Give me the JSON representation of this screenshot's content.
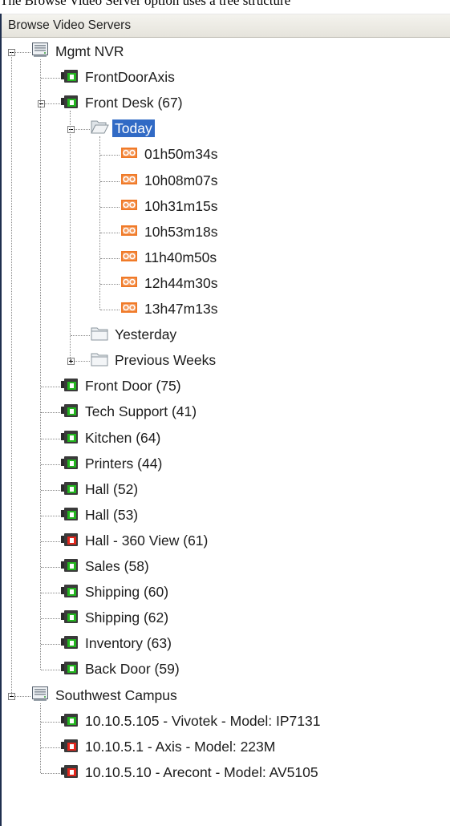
{
  "caption": "The Browse Video Server option uses a tree structure",
  "panel": {
    "title": "Browse Video Servers"
  },
  "tree": [
    {
      "label": "Mgmt NVR",
      "icon": "server",
      "expand": "minus",
      "children": [
        {
          "label": "FrontDoorAxis",
          "icon": "camera-green"
        },
        {
          "label": "Front Desk (67)",
          "icon": "camera-green",
          "expand": "minus",
          "children": [
            {
              "label": "Today",
              "icon": "folder-open",
              "expand": "minus",
              "selected": true,
              "children": [
                {
                  "label": "01h50m34s",
                  "icon": "clip"
                },
                {
                  "label": "10h08m07s",
                  "icon": "clip"
                },
                {
                  "label": "10h31m15s",
                  "icon": "clip"
                },
                {
                  "label": "10h53m18s",
                  "icon": "clip"
                },
                {
                  "label": "11h40m50s",
                  "icon": "clip"
                },
                {
                  "label": "12h44m30s",
                  "icon": "clip"
                },
                {
                  "label": "13h47m13s",
                  "icon": "clip"
                }
              ]
            },
            {
              "label": "Yesterday",
              "icon": "folder"
            },
            {
              "label": "Previous Weeks",
              "icon": "folder",
              "expand": "plus"
            }
          ]
        },
        {
          "label": "Front Door (75)",
          "icon": "camera-green"
        },
        {
          "label": "Tech Support (41)",
          "icon": "camera-green"
        },
        {
          "label": "Kitchen (64)",
          "icon": "camera-green"
        },
        {
          "label": "Printers (44)",
          "icon": "camera-green"
        },
        {
          "label": "Hall (52)",
          "icon": "camera-green"
        },
        {
          "label": "Hall (53)",
          "icon": "camera-green"
        },
        {
          "label": "Hall - 360 View (61)",
          "icon": "camera-red"
        },
        {
          "label": "Sales (58)",
          "icon": "camera-green"
        },
        {
          "label": "Shipping (60)",
          "icon": "camera-green"
        },
        {
          "label": "Shipping (62)",
          "icon": "camera-green"
        },
        {
          "label": "Inventory (63)",
          "icon": "camera-green"
        },
        {
          "label": "Back Door (59)",
          "icon": "camera-green"
        }
      ]
    },
    {
      "label": "Southwest Campus",
      "icon": "server",
      "expand": "minus",
      "children": [
        {
          "label": "10.10.5.105 - Vivotek - Model: IP7131",
          "icon": "camera-green"
        },
        {
          "label": "10.10.5.1 - Axis - Model: 223M",
          "icon": "camera-red"
        },
        {
          "label": "10.10.5.10 - Arecont - Model: AV5105",
          "icon": "camera-red"
        }
      ]
    }
  ],
  "colors": {
    "selection": "#316ac5",
    "camera_ok": "#22b41e",
    "camera_alert": "#e2261c",
    "clip": "#f07a28"
  }
}
